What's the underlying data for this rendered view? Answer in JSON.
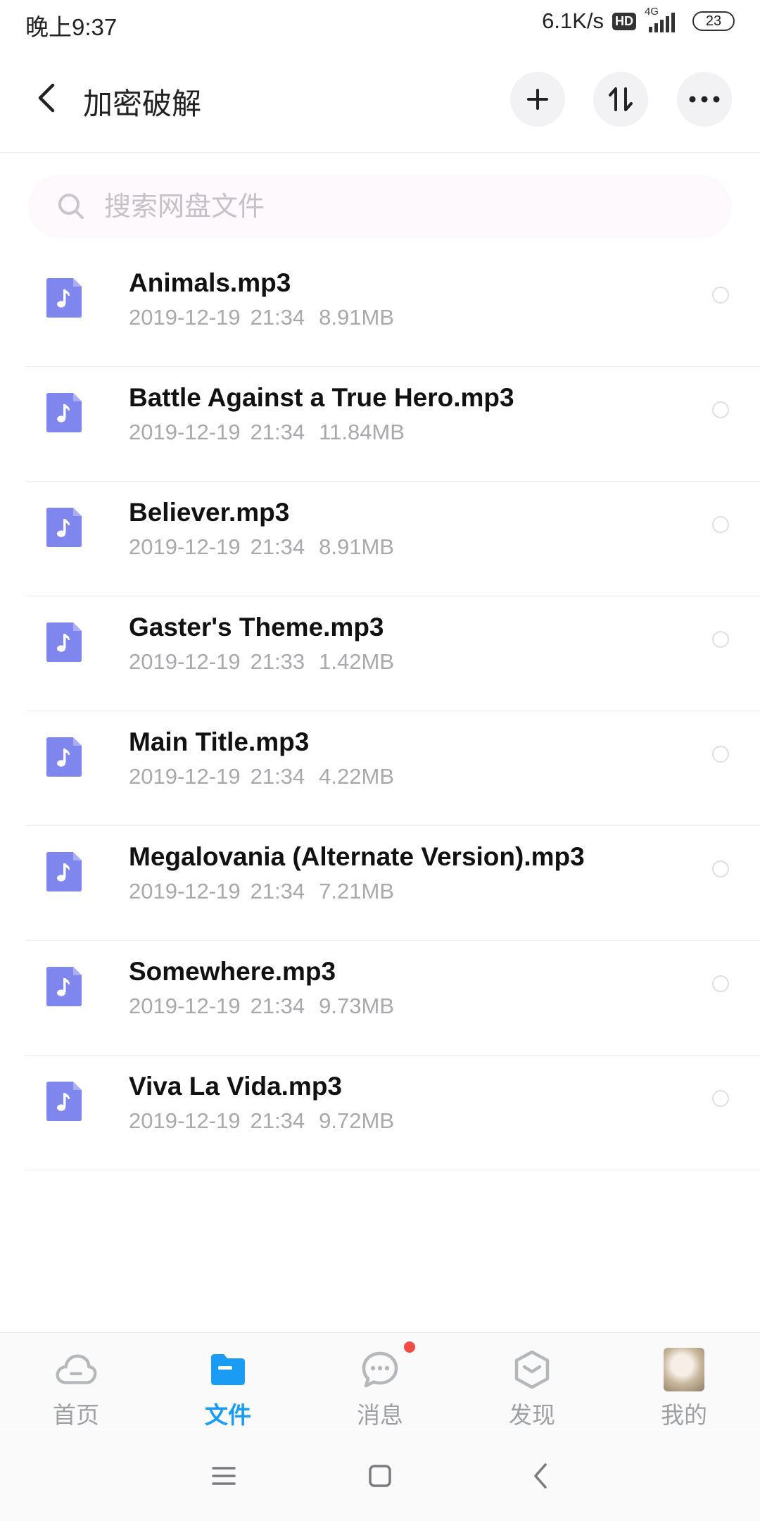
{
  "status_bar": {
    "time": "晚上9:37",
    "network_speed": "6.1K/s",
    "hd_label": "HD",
    "network_type": "4G",
    "battery": "23"
  },
  "header": {
    "title": "加密破解"
  },
  "search": {
    "placeholder": "搜索网盘文件"
  },
  "files": [
    {
      "name": "Animals.mp3",
      "date": "2019-12-19",
      "time": "21:34",
      "size": "8.91MB"
    },
    {
      "name": "Battle Against a True Hero.mp3",
      "date": "2019-12-19",
      "time": "21:34",
      "size": "11.84MB"
    },
    {
      "name": "Believer.mp3",
      "date": "2019-12-19",
      "time": "21:34",
      "size": "8.91MB"
    },
    {
      "name": "Gaster's Theme.mp3",
      "date": "2019-12-19",
      "time": "21:33",
      "size": "1.42MB"
    },
    {
      "name": "Main Title.mp3",
      "date": "2019-12-19",
      "time": "21:34",
      "size": "4.22MB"
    },
    {
      "name": "Megalovania (Alternate Version).mp3",
      "date": "2019-12-19",
      "time": "21:34",
      "size": "7.21MB"
    },
    {
      "name": "Somewhere.mp3",
      "date": "2019-12-19",
      "time": "21:34",
      "size": "9.73MB"
    },
    {
      "name": "Viva La Vida.mp3",
      "date": "2019-12-19",
      "time": "21:34",
      "size": "9.72MB"
    }
  ],
  "bottom_nav": {
    "items": [
      {
        "label": "首页",
        "icon": "cloud-icon"
      },
      {
        "label": "文件",
        "icon": "folder-icon",
        "active": true
      },
      {
        "label": "消息",
        "icon": "chat-icon",
        "badge": true
      },
      {
        "label": "发现",
        "icon": "discover-icon"
      },
      {
        "label": "我的",
        "icon": "avatar"
      }
    ]
  },
  "colors": {
    "accent": "#1a9cf4",
    "file_icon": "#7f86ee",
    "badge": "#f04b44",
    "meta_text": "#a9a9ad"
  }
}
